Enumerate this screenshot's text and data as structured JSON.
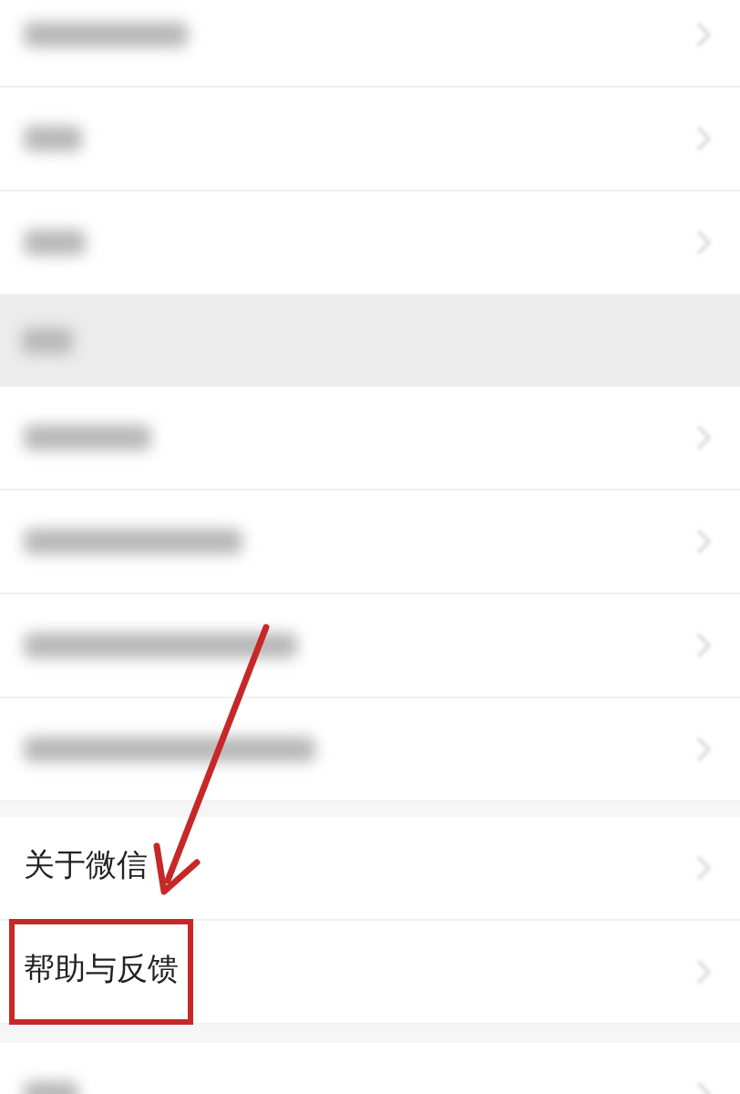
{
  "sections": [
    {
      "items": [
        {
          "kind": "blurred",
          "highlighted": false
        },
        {
          "kind": "blurred",
          "highlighted": false
        },
        {
          "kind": "blurred",
          "highlighted": false
        }
      ]
    },
    {
      "header": {
        "kind": "blurred"
      },
      "items": [
        {
          "kind": "blurred",
          "highlighted": false
        },
        {
          "kind": "blurred",
          "highlighted": false
        },
        {
          "kind": "blurred",
          "highlighted": false
        },
        {
          "kind": "blurred",
          "highlighted": false
        }
      ]
    },
    {
      "items": [
        {
          "kind": "text",
          "label": "关于微信",
          "highlighted": false
        },
        {
          "kind": "text",
          "label": "帮助与反馈",
          "highlighted": true
        }
      ]
    },
    {
      "items": [
        {
          "kind": "blurred",
          "highlighted": false
        }
      ]
    }
  ],
  "annotation_arrow": true
}
